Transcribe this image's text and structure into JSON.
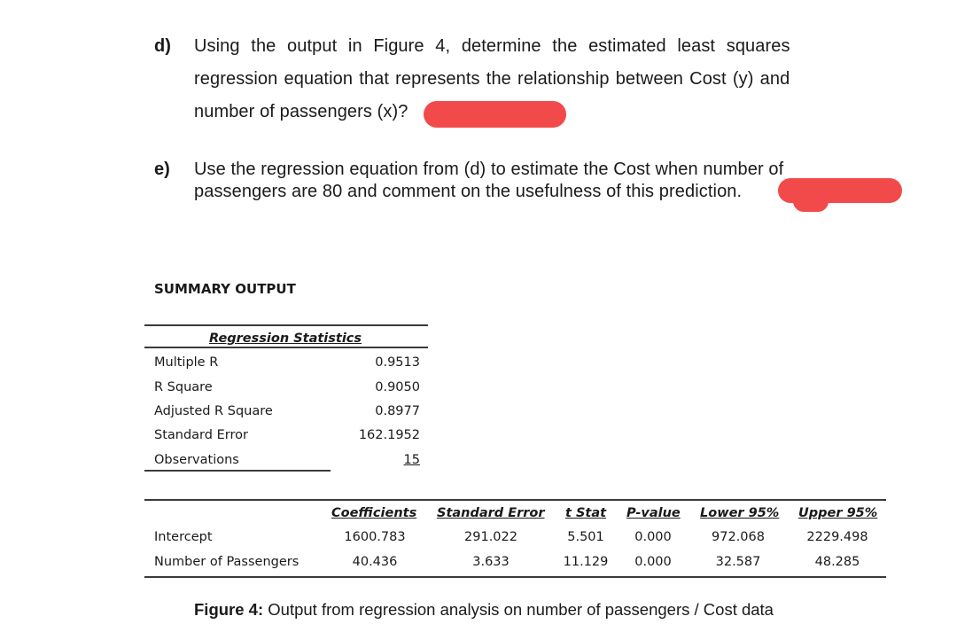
{
  "questions": {
    "d": {
      "label": "d)",
      "lines": [
        "Using the output in Figure 4, determine the estimated least squares",
        "regression equation that represents the relationship between Cost (y) and",
        "number of passengers (x)?"
      ]
    },
    "e": {
      "label": "e)",
      "lines": [
        "Use the regression equation from (d) to estimate the Cost when number of",
        "passengers are 80 and comment on the usefulness of this prediction."
      ]
    }
  },
  "redaction_color": "#f24a4a",
  "summary": {
    "title": "SUMMARY OUTPUT",
    "regression_statistics": {
      "heading": "Regression Statistics",
      "rows": [
        {
          "label": "Multiple R",
          "value": "0.9513"
        },
        {
          "label": "R Square",
          "value": "0.9050"
        },
        {
          "label": "Adjusted R Square",
          "value": "0.8977"
        },
        {
          "label": "Standard Error",
          "value": "162.1952"
        },
        {
          "label": "Observations",
          "value": "15"
        }
      ]
    },
    "coefficients_table": {
      "headers": [
        "Coefficients",
        "Standard Error",
        "t Stat",
        "P-value",
        "Lower 95%",
        "Upper 95%"
      ],
      "rows": [
        {
          "label": "Intercept",
          "values": [
            "1600.783",
            "291.022",
            "5.501",
            "0.000",
            "972.068",
            "2229.498"
          ]
        },
        {
          "label": "Number of Passengers",
          "values": [
            "40.436",
            "3.633",
            "11.129",
            "0.000",
            "32.587",
            "48.285"
          ]
        }
      ]
    }
  },
  "caption": {
    "prefix": "Figure 4:",
    "text": " Output from regression analysis on number of passengers / Cost data"
  }
}
